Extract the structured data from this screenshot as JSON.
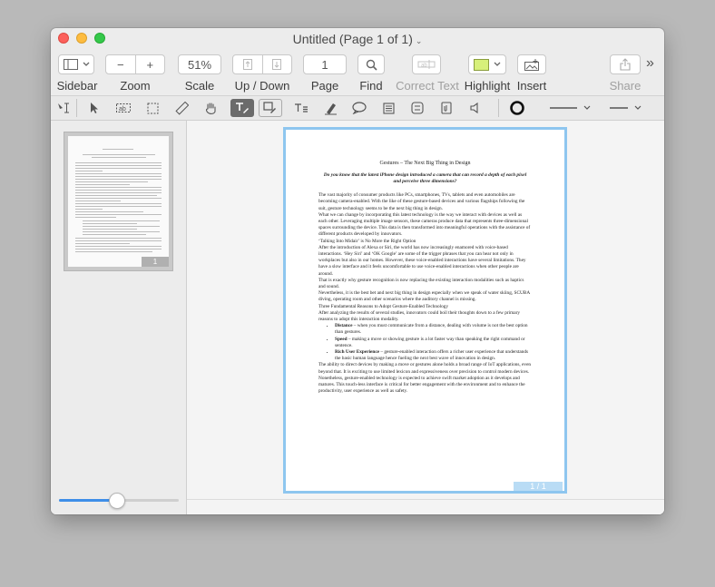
{
  "window": {
    "title": "Untitled (Page 1 of 1)",
    "title_chevron": "⌄"
  },
  "toolbar": {
    "sidebar_label": "Sidebar",
    "zoom_label": "Zoom",
    "zoom_minus": "−",
    "zoom_plus": "+",
    "scale_value": "51%",
    "scale_label": "Scale",
    "updown_label": "Up / Down",
    "page_value": "1",
    "page_label": "Page",
    "find_label": "Find",
    "correct_text_label": "Correct Text",
    "highlight_label": "Highlight",
    "highlight_color": "#d7f07a",
    "insert_label": "Insert",
    "share_label": "Share",
    "overflow_icon": "»"
  },
  "annotation_bar": {
    "icons": [
      "text-select-icon",
      "pointer-icon",
      "ocr-icon",
      "rect-select-icon",
      "ruler-icon",
      "hand-icon",
      "text-annotate-icon",
      "shape-annotate-icon",
      "text-box-icon",
      "highlighter-icon",
      "comment-icon",
      "note-icon",
      "stamp-icon",
      "attachment-icon",
      "audio-icon",
      "stroke-circle-icon",
      "line-style-icon",
      "line-end-icon"
    ]
  },
  "sidebar": {
    "thumbnail_page_label": "1",
    "zoom_slider_fraction": 0.48
  },
  "document": {
    "title": "Gestures – The Next Big Thing in Design",
    "subtitle": "Do you know that the latest iPhone design introduced a camera that can record a depth of each pixel and perceive three dimensions?",
    "p1": "The vast majority of consumer products like PCs, smartphones, TVs, tablets and even automobiles are becoming camera-enabled. With the like of these gesture-based devices and various flagships following the suit, gesture technology seems to be the next big thing in design.",
    "p2": "What we can change by incorporating this latest technology is the way we interact with devices as well as each other. Leveraging multiple image sensors, these cameras produce data that represents three-dimensional spaces surrounding the device. This data is then transformed into meaningful operations with the assistance of different products developed by innovators.",
    "p3": "‘Talking Into Midair’ is No More the Right Option",
    "p4": "After the introduction of Alexa or Siri, the world has now increasingly enamored with voice-based interactions. ‘Hey Siri’ and ‘OK Google’ are some of the trigger phrases that you can hear not only in workplaces but also in our homes. However, these voice-enabled interactions have several limitations. They have a slow interface and it feels uncomfortable to use voice-enabled interactions when other people are around.",
    "p5": "That is exactly why gesture recognition is now replacing the existing interaction modalities such as haptics and sound.",
    "p6": "Nevertheless, it is the best bet and next big thing in design especially when we speak of water skiing, SCUBA diving, operating room and other scenarios where the auditory channel is missing.",
    "p7": "Three Fundamental Reasons to Adopt Gesture-Enabled Technology",
    "p8": "After analyzing the results of several studies, innovators could boil their thoughts down to a few primary reasons to adopt this interaction modality.",
    "bullets": [
      {
        "term": "Distance",
        "text": " – when you must communicate from a distance, dealing with volume is not the best option than gestures."
      },
      {
        "term": "Speed",
        "text": " – making a move or showing gesture is a lot faster way than speaking the right command or sentence."
      },
      {
        "term": "Rich User Experience",
        "text": " – gesture-enabled interaction offers a richer user experience that understands the basic human language hence fueling the next best wave of innovation in design."
      }
    ],
    "p9": "The ability to direct devices by making a move or gestures alone holds a broad range of IoT applications, even beyond that. It is exciting to use limited lexicon and expressiveness over precision to control modern devices.",
    "p10": "Nonetheless, gesture-enabled technology is expected to achieve swift market adoption as it develops and matures. This touch-less interface is critical for better engagement with the environment and to enhance the productivity, user experience as well as safety.",
    "page_badge": "1 / 1"
  }
}
